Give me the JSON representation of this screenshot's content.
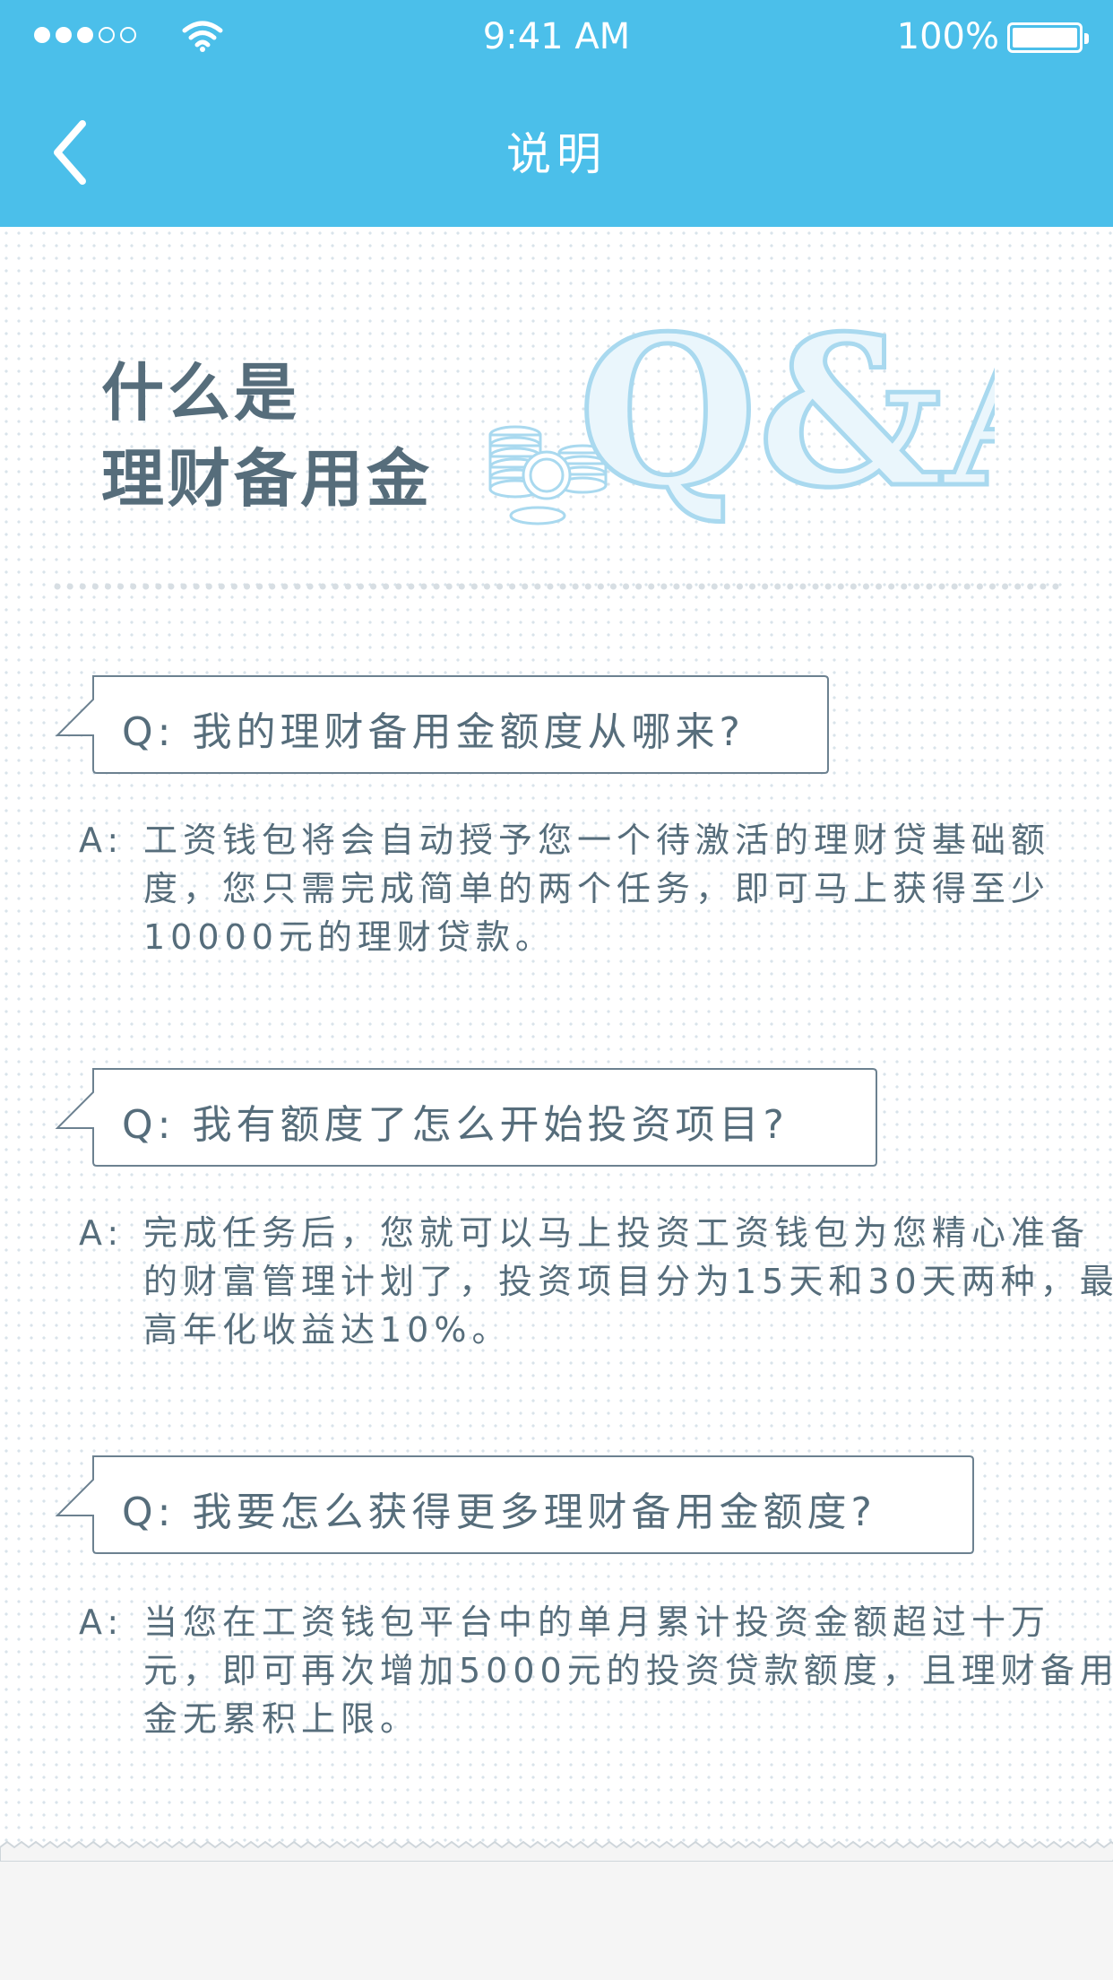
{
  "status_bar": {
    "time": "9:41 AM",
    "battery": "100%",
    "signal_dots_filled": 3,
    "signal_dots_total": 5
  },
  "nav": {
    "title": "说明",
    "back_icon": "chevron-left-icon"
  },
  "hero": {
    "title_line1": "什么是",
    "title_line2": "理财备用金",
    "art_text": "Q&A"
  },
  "qa": [
    {
      "question": "Q: 我的理财备用金额度从哪来?",
      "answer_prefix": "A:",
      "answer": "工资钱包将会自动授予您一个待激活的理财贷基础额度，您只需完成简单的两个任务，即可马上获得至少10000元的理财贷款。"
    },
    {
      "question": "Q: 我有额度了怎么开始投资项目?",
      "answer_prefix": "A:",
      "answer": "完成任务后，您就可以马上投资工资钱包为您精心准备的财富管理计划了，投资项目分为15天和30天两种，最高年化收益达10%。"
    },
    {
      "question": "Q: 我要怎么获得更多理财备用金额度?",
      "answer_prefix": "A:",
      "answer": "当您在工资钱包平台中的单月累计投资金额超过十万元，即可再次增加5000元的投资贷款额度，且理财备用金无累积上限。"
    }
  ],
  "colors": {
    "header_bg": "#4bbfea",
    "text": "#566d7b",
    "art": "#a9d9ef"
  }
}
